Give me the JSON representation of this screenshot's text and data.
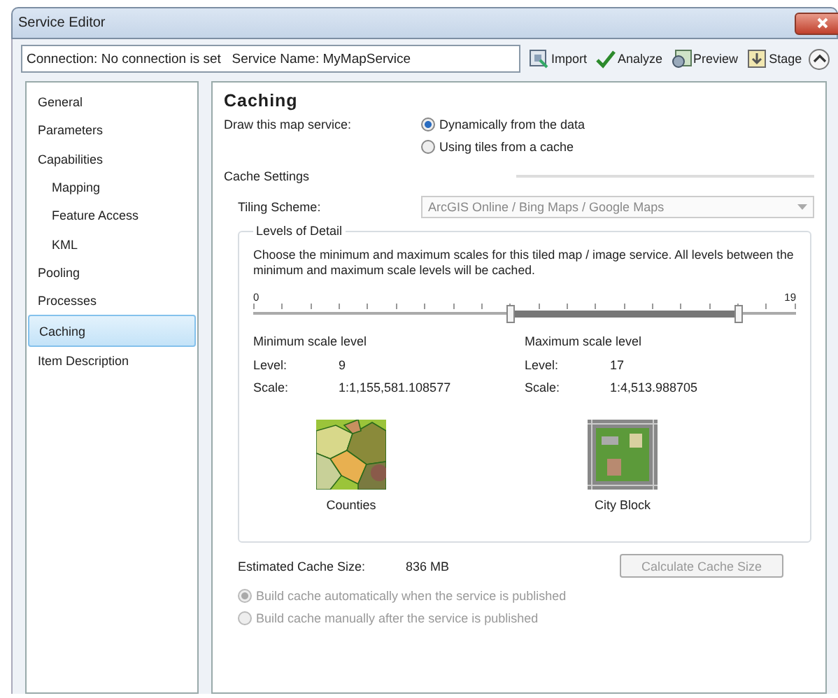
{
  "window": {
    "title": "Service Editor"
  },
  "toolbar": {
    "connection_info": "Connection: No connection is set   Service Name: MyMapService",
    "buttons": [
      {
        "kind": "import",
        "label": "Import"
      },
      {
        "kind": "analyze",
        "label": "Analyze"
      },
      {
        "kind": "preview",
        "label": "Preview"
      },
      {
        "kind": "stage",
        "label": "Stage"
      }
    ]
  },
  "sidebar": {
    "items": [
      {
        "label": "General",
        "selected": false
      },
      {
        "label": "Parameters",
        "selected": false
      },
      {
        "label": "Capabilities",
        "selected": false,
        "children": [
          {
            "label": "Mapping",
            "selected": false
          },
          {
            "label": "Feature Access",
            "selected": false
          },
          {
            "label": "KML",
            "selected": false
          }
        ]
      },
      {
        "label": "Pooling",
        "selected": false
      },
      {
        "label": "Processes",
        "selected": false
      },
      {
        "label": "Caching",
        "selected": true
      },
      {
        "label": "Item Description",
        "selected": false
      }
    ]
  },
  "content": {
    "title": "Caching",
    "draw_label": "Draw this map service:",
    "draw_options": [
      {
        "label": "Dynamically from the data",
        "selected": true
      },
      {
        "label": "Using tiles from a cache",
        "selected": false
      }
    ],
    "cache_settings_label": "Cache Settings",
    "tiling_scheme": {
      "label": "Tiling Scheme:",
      "value": "ArcGIS Online / Bing Maps / Google Maps",
      "disabled": true
    },
    "levels_of_detail": {
      "legend": "Levels of Detail",
      "description": "Choose the minimum and maximum scales for this tiled map / image service. All levels between the minimum and maximum scale levels will be cached.",
      "slider": {
        "min_label": "0",
        "max_label": "19",
        "min_thumb": {
          "level": 0.4737
        },
        "max_thumb": {
          "level": 0.8947
        }
      },
      "ends": [
        {
          "heading": "Minimum scale level",
          "level_label": "Level:",
          "level_value": "9",
          "scale_label": "Scale:",
          "scale_value": "1:1,155,581.108577",
          "kind": "counties",
          "caption": "Counties"
        },
        {
          "heading": "Maximum scale level",
          "level_label": "Level:",
          "level_value": "17",
          "scale_label": "Scale:",
          "scale_value": "1:4,513.988705",
          "kind": "cityblock",
          "caption": "City Block"
        }
      ]
    },
    "estimated_label": "Estimated Cache Size:",
    "estimated_value": "836 MB",
    "calculate_button": {
      "label": "Calculate Cache Size",
      "disabled": true
    },
    "build_options": [
      {
        "label": "Build cache automatically when the service is published",
        "selected": true,
        "disabled": true
      },
      {
        "label": "Build cache manually after the service is published",
        "selected": false,
        "disabled": true
      }
    ]
  }
}
